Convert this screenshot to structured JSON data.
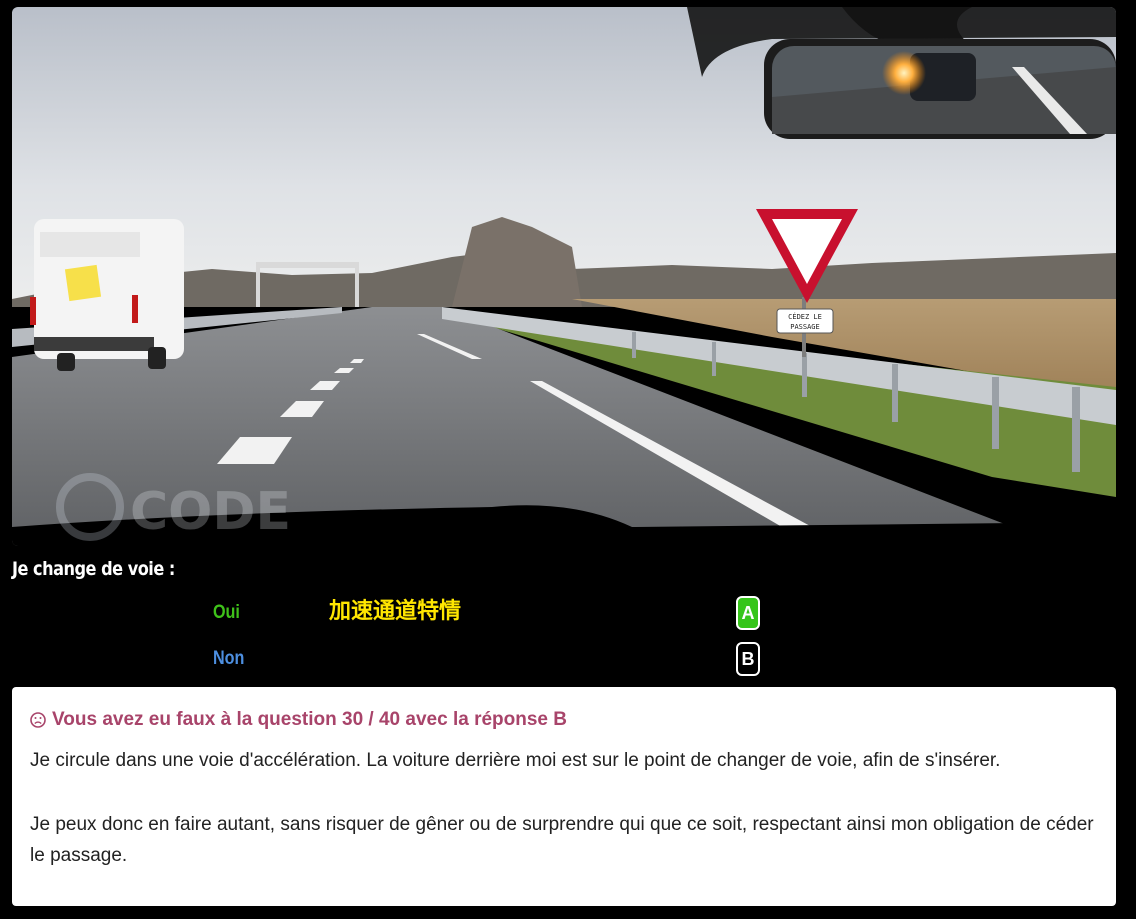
{
  "scene": {
    "sign_text_line1": "CÉDEZ LE",
    "sign_text_line2": "PASSAGE",
    "van_sign_text": "",
    "watermark": "CODE"
  },
  "question": {
    "text": "Je change de voie :"
  },
  "answers": [
    {
      "label": "Oui",
      "key": "A",
      "color": "#3fc21a",
      "selected": true
    },
    {
      "label": "Non",
      "key": "B",
      "color": "#4d8fe0",
      "selected": false
    }
  ],
  "overlay_note": "加速通道特情",
  "feedback": {
    "icon": "sad-face-icon",
    "title": "Vous avez eu faux à la question 30 / 40 avec la réponse B",
    "paragraph1": "Je circule dans une voie d'accélération. La voiture derrière moi est sur le point de changer de voie, afin de s'insérer.",
    "paragraph2": "Je peux donc en faire autant, sans risquer de gêner ou de surprendre qui que ce soit, respectant ainsi mon obligation de céder le passage.",
    "title_color": "#a8446a"
  }
}
